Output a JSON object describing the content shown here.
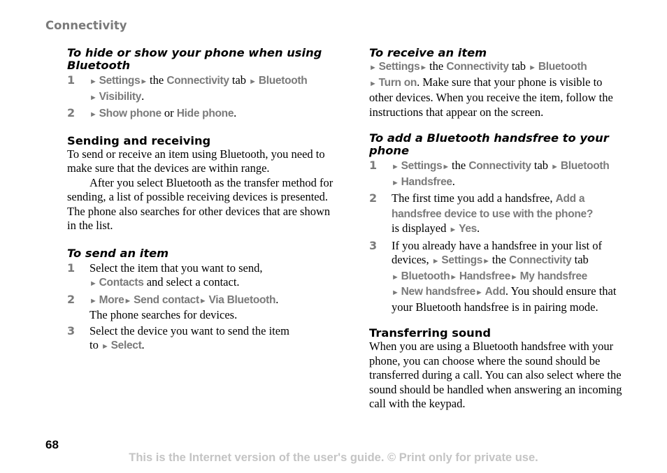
{
  "header": "Connectivity",
  "page_number": "68",
  "footer": "This is the Internet version of the user's guide. © Print only for private use.",
  "arrow": "►",
  "left": {
    "hide_show": {
      "title": "To hide or show your phone when using Bluetooth",
      "steps": [
        {
          "num": "1",
          "parts": [
            [
              "a",
              ""
            ],
            [
              "m",
              "Settings"
            ],
            [
              "a",
              ""
            ],
            [
              "t",
              " the "
            ],
            [
              "m",
              "Connectivity"
            ],
            [
              "t",
              " tab "
            ],
            [
              "a",
              ""
            ],
            [
              "m",
              "Bluetooth"
            ],
            [
              "br",
              ""
            ],
            [
              "a",
              ""
            ],
            [
              "m",
              "Visibility"
            ],
            [
              "t",
              "."
            ]
          ]
        },
        {
          "num": "2",
          "parts": [
            [
              "a",
              ""
            ],
            [
              "m",
              "Show phone"
            ],
            [
              "t",
              " or "
            ],
            [
              "m",
              "Hide phone"
            ],
            [
              "t",
              "."
            ]
          ]
        }
      ]
    },
    "sending": {
      "title": "Sending and receiving",
      "p1": "To send or receive an item using Bluetooth, you need to make sure that the devices are within range.",
      "p2": "After you select Bluetooth as the transfer method for sending, a list of possible receiving devices is presented. The phone also searches for other devices that are shown in the list."
    },
    "send_item": {
      "title": "To send an item",
      "steps": [
        {
          "num": "1",
          "parts": [
            [
              "t",
              "Select the item that you want to send, "
            ],
            [
              "br",
              ""
            ],
            [
              "a",
              ""
            ],
            [
              "m",
              "Contacts"
            ],
            [
              "t",
              " and select a contact."
            ]
          ]
        },
        {
          "num": "2",
          "parts": [
            [
              "a",
              ""
            ],
            [
              "m",
              "More"
            ],
            [
              "a",
              ""
            ],
            [
              "m",
              "Send contact"
            ],
            [
              "a",
              ""
            ],
            [
              "m",
              "Via Bluetooth"
            ],
            [
              "t",
              "."
            ],
            [
              "br",
              ""
            ],
            [
              "t",
              "The phone searches for devices."
            ]
          ]
        },
        {
          "num": "3",
          "parts": [
            [
              "t",
              "Select the device you want to send the item "
            ],
            [
              "br",
              ""
            ],
            [
              "t",
              "to "
            ],
            [
              "a",
              ""
            ],
            [
              "m",
              "Select"
            ],
            [
              "t",
              "."
            ]
          ]
        }
      ]
    }
  },
  "right": {
    "receive": {
      "title": "To receive an item",
      "parts": [
        [
          "a",
          ""
        ],
        [
          "m",
          "Settings"
        ],
        [
          "a",
          ""
        ],
        [
          "t",
          " the "
        ],
        [
          "m",
          "Connectivity"
        ],
        [
          "t",
          " tab "
        ],
        [
          "a",
          ""
        ],
        [
          "m",
          "Bluetooth"
        ],
        [
          "br",
          ""
        ],
        [
          "a",
          ""
        ],
        [
          "m",
          "Turn on"
        ],
        [
          "t",
          ". Make sure that your phone is visible to other devices. When you receive the item, follow the instructions that appear on the screen."
        ]
      ]
    },
    "handsfree": {
      "title": "To add a Bluetooth handsfree to your phone",
      "steps": [
        {
          "num": "1",
          "parts": [
            [
              "a",
              ""
            ],
            [
              "m",
              "Settings"
            ],
            [
              "a",
              ""
            ],
            [
              "t",
              " the "
            ],
            [
              "m",
              "Connectivity"
            ],
            [
              "t",
              " tab "
            ],
            [
              "a",
              ""
            ],
            [
              "m",
              "Bluetooth"
            ],
            [
              "br",
              ""
            ],
            [
              "a",
              ""
            ],
            [
              "m",
              "Handsfree"
            ],
            [
              "t",
              "."
            ]
          ]
        },
        {
          "num": "2",
          "parts": [
            [
              "t",
              "The first time you add a handsfree, "
            ],
            [
              "m",
              "Add a handsfree device to use with the phone?"
            ],
            [
              "br",
              ""
            ],
            [
              "t",
              "is displayed "
            ],
            [
              "a",
              ""
            ],
            [
              "m",
              "Yes"
            ],
            [
              "t",
              "."
            ]
          ]
        },
        {
          "num": "3",
          "parts": [
            [
              "t",
              "If you already have a handsfree in your list of devices, "
            ],
            [
              "a",
              ""
            ],
            [
              "m",
              "Settings"
            ],
            [
              "a",
              ""
            ],
            [
              "t",
              " the "
            ],
            [
              "m",
              "Connectivity"
            ],
            [
              "t",
              " tab"
            ],
            [
              "br",
              ""
            ],
            [
              "a",
              ""
            ],
            [
              "m",
              "Bluetooth"
            ],
            [
              "a",
              ""
            ],
            [
              "m",
              "Handsfree"
            ],
            [
              "a",
              ""
            ],
            [
              "m",
              "My handsfree"
            ],
            [
              "br",
              ""
            ],
            [
              "a",
              ""
            ],
            [
              "m",
              "New handsfree"
            ],
            [
              "a",
              ""
            ],
            [
              "m",
              "Add"
            ],
            [
              "t",
              ". You should ensure that your Bluetooth handsfree is in pairing mode."
            ]
          ]
        }
      ]
    },
    "transfer": {
      "title": "Transferring sound",
      "p1": "When you are using a Bluetooth handsfree with your phone, you can choose where the sound should be transferred during a call. You can also select where the sound should be handled when answering an incoming call with the keypad."
    }
  }
}
